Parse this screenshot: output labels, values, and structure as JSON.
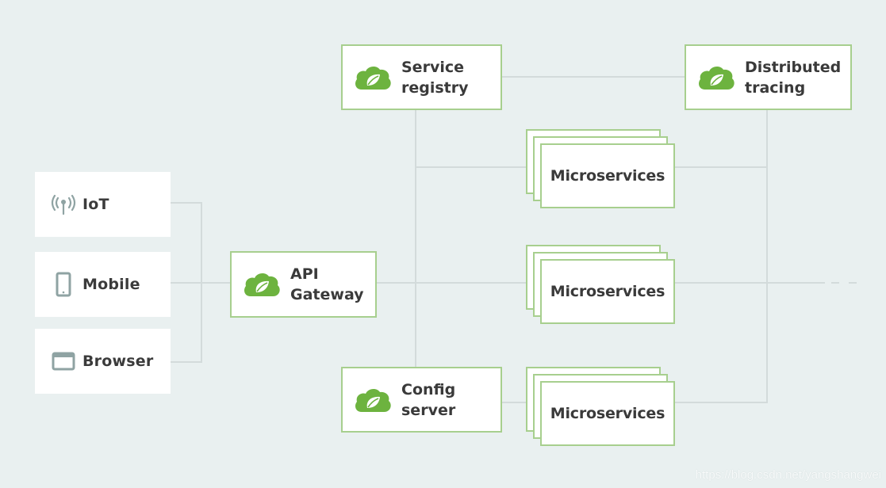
{
  "colors": {
    "background": "#e9f0f0",
    "box_border": "#a7cf8e",
    "spring_green": "#6db33f",
    "connector": "#d3dbdb",
    "icon_gray": "#8fa3a3",
    "text": "#3a3a3a"
  },
  "clients": [
    {
      "label": "IoT",
      "icon": "antenna-icon"
    },
    {
      "label": "Mobile",
      "icon": "mobile-phone-icon"
    },
    {
      "label": "Browser",
      "icon": "browser-window-icon"
    }
  ],
  "gateway": {
    "line1": "API",
    "line2": "Gateway",
    "icon": "spring-cloud-icon"
  },
  "service_registry": {
    "line1": "Service",
    "line2": "registry",
    "icon": "spring-cloud-icon"
  },
  "config_server": {
    "line1": "Config",
    "line2": "server",
    "icon": "spring-cloud-icon"
  },
  "distributed_tracing": {
    "line1": "Distributed",
    "line2": "tracing",
    "icon": "spring-cloud-icon"
  },
  "microservices": [
    {
      "label": "Microservices"
    },
    {
      "label": "Microservices"
    },
    {
      "label": "Microservices"
    }
  ],
  "watermark": "https://blog.csdn.net/yangshangwei"
}
